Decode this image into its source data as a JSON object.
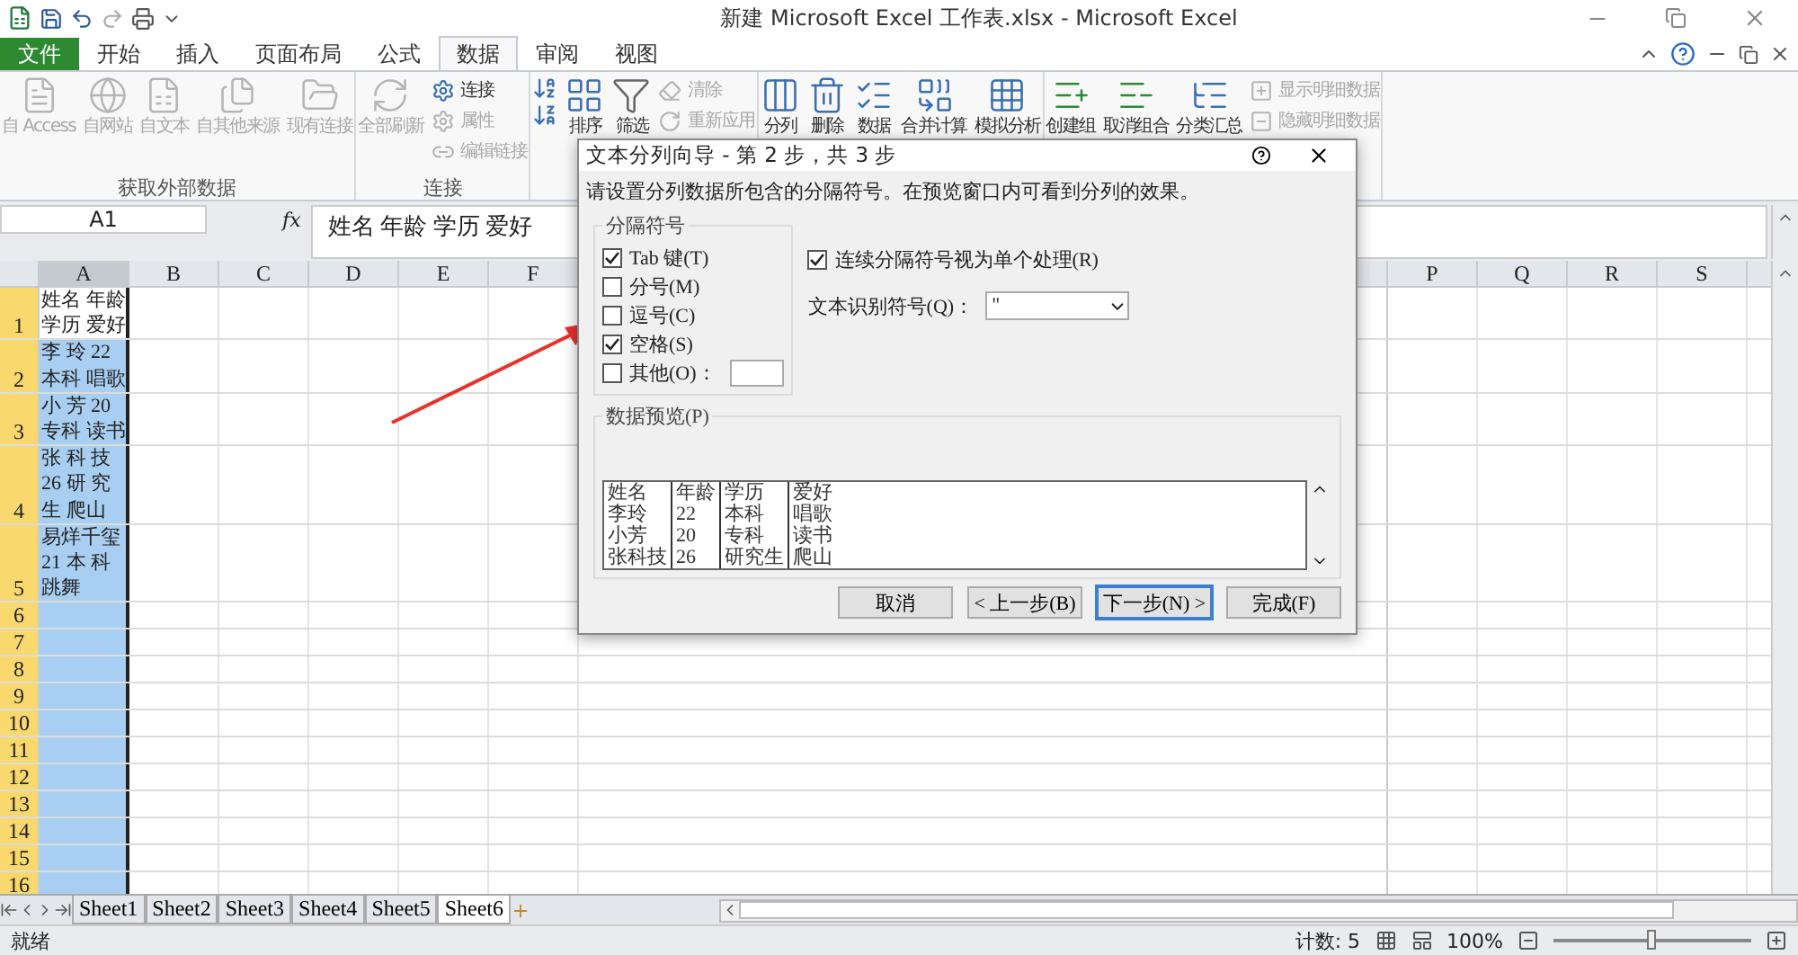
{
  "window": {
    "title": "新建 Microsoft Excel 工作表.xlsx - Microsoft Excel"
  },
  "tabs": [
    {
      "label": "文件",
      "kind": "file",
      "selected": false
    },
    {
      "label": "开始",
      "kind": "tab",
      "selected": false
    },
    {
      "label": "插入",
      "kind": "tab",
      "selected": false
    },
    {
      "label": "页面布局",
      "kind": "tab",
      "selected": false
    },
    {
      "label": "公式",
      "kind": "tab",
      "selected": false
    },
    {
      "label": "数据",
      "kind": "tab",
      "selected": true
    },
    {
      "label": "审阅",
      "kind": "tab",
      "selected": false
    },
    {
      "label": "视图",
      "kind": "tab",
      "selected": false
    }
  ],
  "ribbon": {
    "groups": [
      {
        "label": "获取外部数据",
        "items": [
          {
            "label": "自 Access",
            "kind": "large",
            "disabled": true
          },
          {
            "label": "自网站",
            "kind": "large",
            "disabled": true
          },
          {
            "label": "自文本",
            "kind": "large",
            "disabled": true
          },
          {
            "label": "自其他来源",
            "kind": "large",
            "disabled": true
          },
          {
            "label": "现有连接",
            "kind": "large",
            "disabled": true
          }
        ]
      },
      {
        "label": "连接",
        "items": [
          {
            "label": "全部刷新",
            "kind": "large",
            "disabled": true
          },
          {
            "label": "连接",
            "kind": "small",
            "disabled": false
          },
          {
            "label": "属性",
            "kind": "small",
            "disabled": true
          },
          {
            "label": "编辑链接",
            "kind": "small",
            "disabled": true
          }
        ]
      },
      {
        "items": [
          {
            "label": "排序",
            "kind": "large",
            "disabled": false
          },
          {
            "label": "筛选",
            "kind": "large",
            "disabled": false
          },
          {
            "label": "清除",
            "kind": "small",
            "disabled": true
          },
          {
            "label": "重新应用",
            "kind": "small",
            "disabled": true
          }
        ]
      },
      {
        "items": [
          {
            "label": "分列",
            "kind": "large",
            "disabled": false
          },
          {
            "label": "删除",
            "kind": "large",
            "disabled": false
          },
          {
            "label": "数据",
            "kind": "large",
            "disabled": false
          },
          {
            "label": "合并计算",
            "kind": "large",
            "disabled": false
          },
          {
            "label": "模拟分析",
            "kind": "large",
            "disabled": false
          }
        ]
      },
      {
        "items": [
          {
            "label": "创建组",
            "kind": "large",
            "disabled": false
          },
          {
            "label": "取消组合",
            "kind": "large",
            "disabled": false
          },
          {
            "label": "分类汇总",
            "kind": "large",
            "disabled": false
          },
          {
            "label": "显示明细数据",
            "kind": "small",
            "disabled": true
          },
          {
            "label": "隐藏明细数据",
            "kind": "small",
            "disabled": true
          }
        ]
      }
    ]
  },
  "formula_bar": {
    "name_box": "A1",
    "function_label": "fx",
    "content": "姓名 年龄 学历 爱好"
  },
  "sheet": {
    "columns": [
      {
        "label": "A",
        "selected": true
      },
      {
        "label": "B",
        "selected": false
      },
      {
        "label": "C",
        "selected": false
      },
      {
        "label": "D",
        "selected": false
      },
      {
        "label": "E",
        "selected": false
      },
      {
        "label": "F",
        "selected": false
      },
      {
        "label": "P",
        "selected": false
      },
      {
        "label": "Q",
        "selected": false
      },
      {
        "label": "R",
        "selected": false
      },
      {
        "label": "S",
        "selected": false
      }
    ],
    "rows": [
      {
        "label": "1",
        "selected": true,
        "active": true,
        "cell_lines": [
          "姓名 年龄",
          "学历 爱好"
        ]
      },
      {
        "label": "2",
        "selected": true,
        "active": false,
        "cell_lines": [
          "李 玲 22",
          "本科 唱歌"
        ]
      },
      {
        "label": "3",
        "selected": true,
        "active": false,
        "cell_lines": [
          "小 芳 20",
          "专科 读书"
        ]
      },
      {
        "label": "4",
        "selected": true,
        "active": false,
        "cell_lines": [
          "张 科 技",
          "26 研 究",
          "生 爬山"
        ]
      },
      {
        "label": "5",
        "selected": true,
        "active": false,
        "cell_lines": [
          "易烊千玺",
          "21 本 科",
          "跳舞"
        ]
      },
      {
        "label": "6",
        "selected": true,
        "active": false
      },
      {
        "label": "7",
        "selected": true,
        "active": false
      },
      {
        "label": "8",
        "selected": true,
        "active": false
      },
      {
        "label": "9",
        "selected": true,
        "active": false
      },
      {
        "label": "10",
        "selected": true,
        "active": false
      },
      {
        "label": "11",
        "selected": true,
        "active": false
      },
      {
        "label": "12",
        "selected": true,
        "active": false
      },
      {
        "label": "13",
        "selected": true,
        "active": false
      },
      {
        "label": "14",
        "selected": true,
        "active": false
      },
      {
        "label": "15",
        "selected": true,
        "active": false
      },
      {
        "label": "16",
        "selected": true,
        "active": false
      }
    ]
  },
  "sheet_tabs": [
    {
      "label": "Sheet1",
      "selected": false
    },
    {
      "label": "Sheet2",
      "selected": false
    },
    {
      "label": "Sheet3",
      "selected": false
    },
    {
      "label": "Sheet4",
      "selected": false
    },
    {
      "label": "Sheet5",
      "selected": false
    },
    {
      "label": "Sheet6",
      "selected": true
    }
  ],
  "status_bar": {
    "mode": "就绪",
    "count": "计数: 5",
    "zoom": "100%",
    "level": 0.5
  },
  "dialog": {
    "title": "文本分列向导 - 第 2 步，共 3 步",
    "instruction": "请设置分列数据所包含的分隔符号。在预览窗口内可看到分列的效果。",
    "delimiter_group": "分隔符号",
    "delimiters": [
      {
        "label": "Tab 键(T)",
        "checked": true
      },
      {
        "label": "分号(M)",
        "checked": false
      },
      {
        "label": "逗号(C)",
        "checked": false
      },
      {
        "label": "空格(S)",
        "checked": true
      }
    ],
    "other_delimiter": {
      "label": "其他(O)：",
      "checked": false
    },
    "consecutive": {
      "label": "连续分隔符号视为单个处理(R)",
      "checked": true
    },
    "qualifier": {
      "label": "文本识别符号(Q)：",
      "value": "\""
    },
    "preview": {
      "label": "数据预览(P)",
      "rows": [
        [
          "姓名",
          "年龄",
          "学历",
          "爱好"
        ],
        [
          "李玲",
          "22",
          "本科",
          "唱歌"
        ],
        [
          "小芳",
          "20",
          "专科",
          "读书"
        ],
        [
          "张科技",
          "26",
          "研究生",
          "爬山"
        ]
      ]
    },
    "buttons": [
      {
        "label": "取消",
        "default": false
      },
      {
        "label": "< 上一步(B)",
        "default": false
      },
      {
        "label": "下一步(N) >",
        "default": true
      },
      {
        "label": "完成(F)",
        "default": false
      }
    ]
  }
}
